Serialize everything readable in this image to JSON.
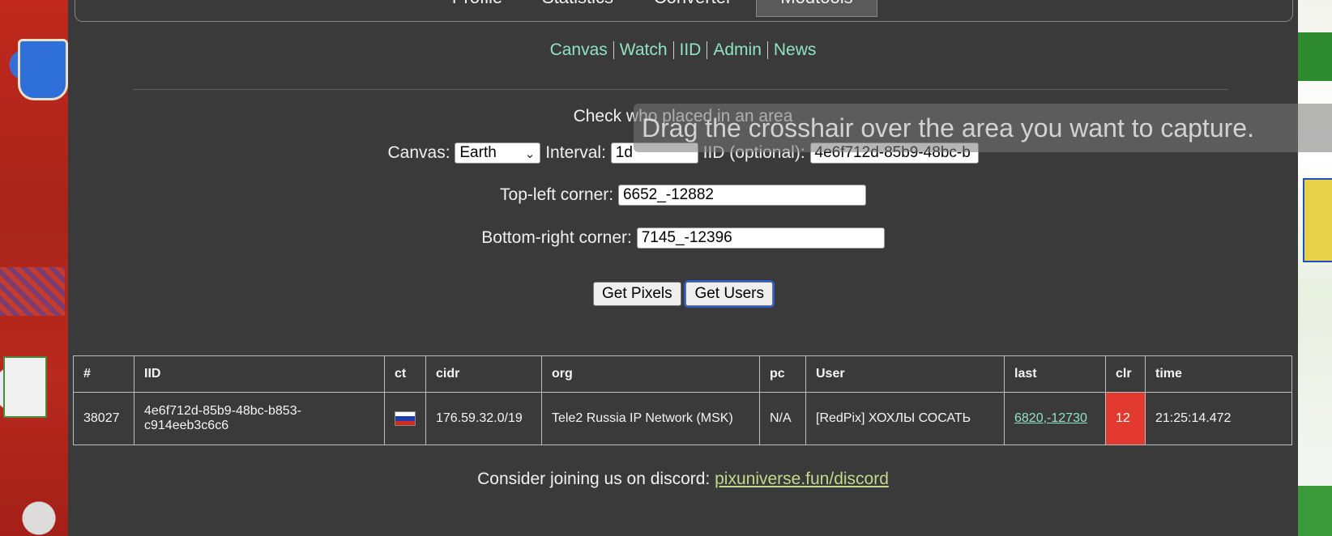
{
  "tabs": [
    {
      "label": "Profile",
      "active": false
    },
    {
      "label": "Statistics",
      "active": false
    },
    {
      "label": "Converter",
      "active": false
    },
    {
      "label": "Modtools",
      "active": true
    }
  ],
  "subnav": [
    "Canvas",
    "Watch",
    "IID",
    "Admin",
    "News"
  ],
  "heading": "Check who placed in an area",
  "form": {
    "canvas_label": "Canvas:",
    "canvas_value": "Earth",
    "interval_label": "Interval:",
    "interval_value": "1d",
    "iid_label": "IID (optional):",
    "iid_value": "4e6f712d-85b9-48bc-b",
    "top_left_label": "Top-left corner:",
    "top_left_value": "6652_-12882",
    "bottom_right_label": "Bottom-right corner:",
    "bottom_right_value": "7145_-12396"
  },
  "buttons": {
    "get_pixels": "Get Pixels",
    "get_users": "Get Users"
  },
  "table": {
    "headers": [
      "#",
      "IID",
      "ct",
      "cidr",
      "org",
      "pc",
      "User",
      "last",
      "clr",
      "time"
    ],
    "rows": [
      {
        "num": "38027",
        "iid_line1": "4e6f712d-85b9-48bc-b853-",
        "iid_line2": "c914eeb3c6c6",
        "ct": "ru-flag",
        "cidr": "176.59.32.0/19",
        "org": "Tele2 Russia IP Network (MSK)",
        "pc": "N/A",
        "user": "[RedPix] ХОХЛЫ СОСАТЬ",
        "last": "6820,-12730",
        "clr": "12",
        "clr_color": "#e23a2e",
        "time": "21:25:14.472"
      }
    ]
  },
  "footer": {
    "text": "Consider joining us on discord: ",
    "link": "pixuniverse.fun/discord"
  },
  "tooltip": "Drag the crosshair over the area you want to capture."
}
